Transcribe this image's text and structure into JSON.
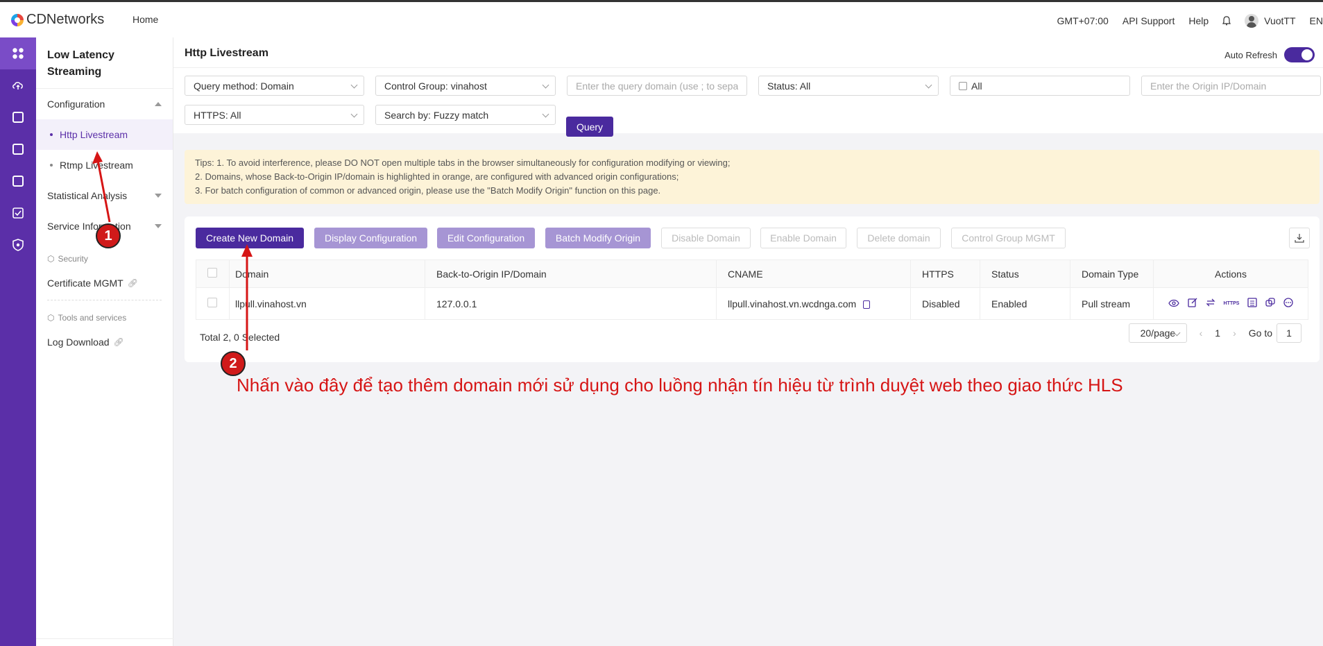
{
  "topbar": {
    "brand": "CDNetworks",
    "home": "Home",
    "timezone": "GMT+07:00",
    "api_support": "API Support",
    "help": "Help",
    "user": "VuotTT",
    "lang": "EN"
  },
  "rail": {
    "icons": [
      "dashboard-icon",
      "cloud-upload-icon",
      "cdn-icon",
      "media-icon",
      "waf-icon",
      "check-icon",
      "shield-icon"
    ]
  },
  "sidebar": {
    "title": "Low Latency Streaming",
    "configuration": "Configuration",
    "http_livestream": "Http Livestream",
    "rtmp_livestream": "Rtmp Livestream",
    "statistical_analysis": "Statistical Analysis",
    "service_information": "Service Information",
    "security_section": "Security",
    "certificate_mgmt": "Certificate MGMT",
    "tools_section": "Tools and services",
    "log_download": "Log Download"
  },
  "page": {
    "title": "Http Livestream",
    "auto_refresh": "Auto Refresh"
  },
  "filters": {
    "query_method": "Query method: Domain",
    "control_group": "Control Group: vinahost",
    "domain_placeholder": "Enter the query domain (use ; to sepa",
    "status": "Status: All",
    "date": "All",
    "origin_placeholder": "Enter the Origin IP/Domain",
    "https": "HTTPS: All",
    "search_by": "Search by: Fuzzy match",
    "query_button": "Query"
  },
  "tips": {
    "line1": "Tips: 1. To avoid interference, please DO NOT open multiple tabs in the browser simultaneously for configuration modifying or viewing;",
    "line2": "2. Domains, whose Back-to-Origin IP/domain is highlighted in orange, are configured with advanced origin configurations;",
    "line3": "3. For batch configuration of common or advanced origin, please use the \"Batch Modify Origin\" function on this page."
  },
  "toolbar": {
    "create": "Create New Domain",
    "display": "Display Configuration",
    "edit": "Edit Configuration",
    "batch": "Batch Modify Origin",
    "disable": "Disable Domain",
    "enable": "Enable Domain",
    "delete": "Delete domain",
    "control_group": "Control Group MGMT"
  },
  "table": {
    "headers": {
      "domain": "Domain",
      "origin": "Back-to-Origin IP/Domain",
      "cname": "CNAME",
      "https": "HTTPS",
      "status": "Status",
      "domain_type": "Domain Type",
      "actions": "Actions"
    },
    "rows": [
      {
        "domain": "llpull.vinahost.vn",
        "origin": "127.0.0.1",
        "cname": "llpull.vinahost.vn.wcdnga.com",
        "https": "Disabled",
        "status": "Enabled",
        "domain_type": "Pull stream"
      }
    ],
    "https_action_label": "HTTPS"
  },
  "footer": {
    "total": "Total 2, 0 Selected",
    "page_size": "20/page",
    "current_page": "1",
    "goto_label": "Go to",
    "goto_value": "1"
  },
  "annotations": {
    "badge1": "1",
    "badge2": "2",
    "note": "Nhấn vào đây để tạo thêm domain mới sử dụng cho luồng nhận tín hiệu từ trình duyệt web theo giao thức HLS"
  },
  "colors": {
    "brand": "#5b2fa8",
    "primary_button": "#4a2a9e",
    "annotation": "#d61515",
    "enabled_status": "#52c41a"
  }
}
